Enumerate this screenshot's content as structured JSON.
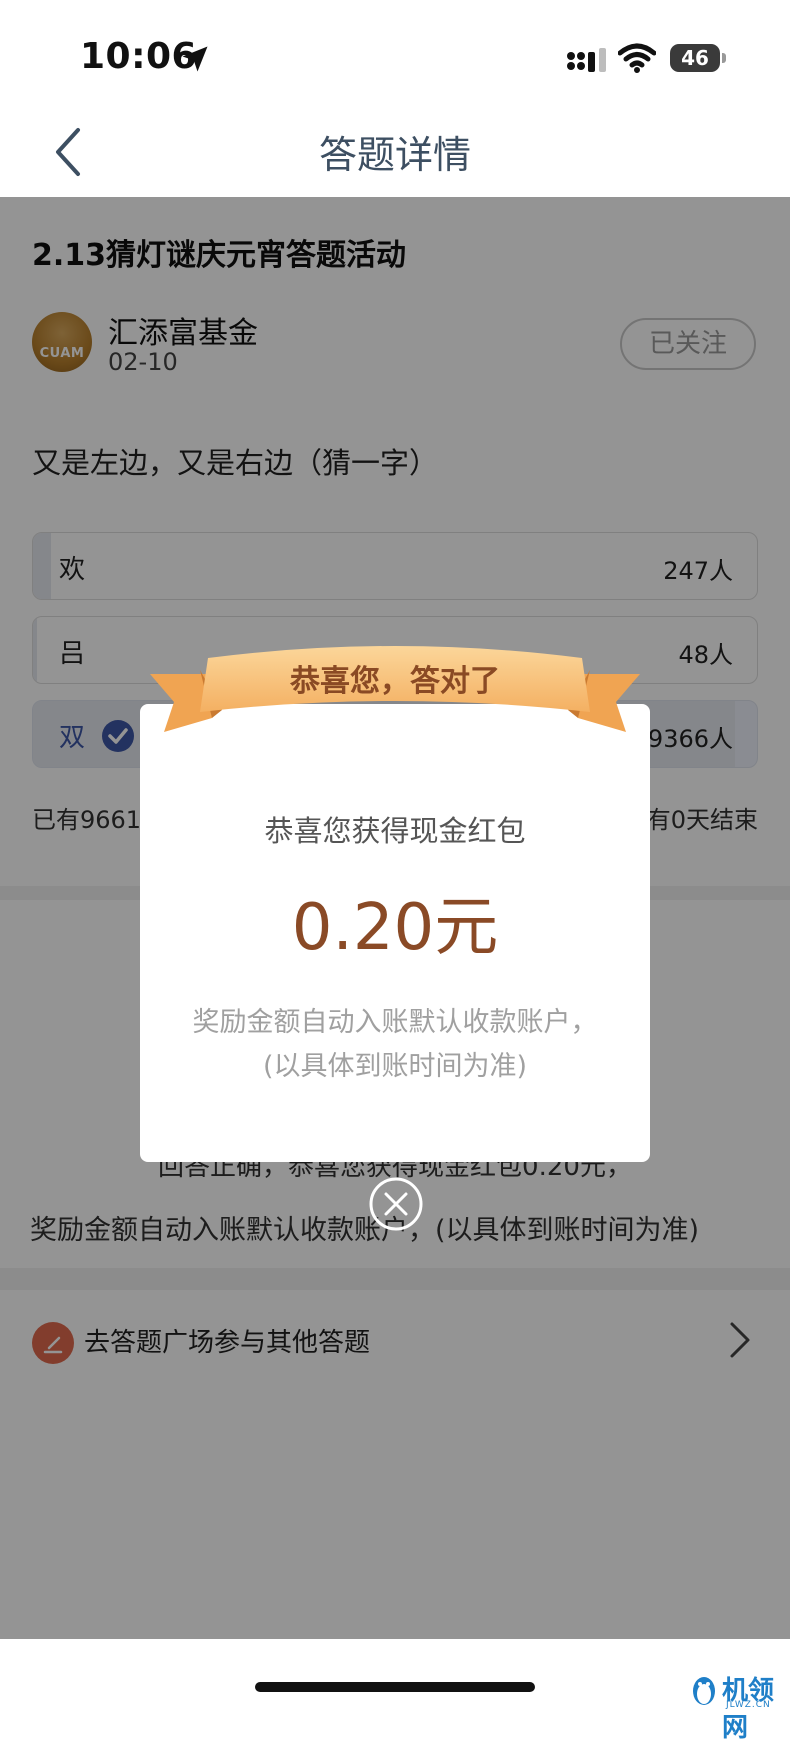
{
  "status_bar": {
    "time": "10:06",
    "battery": "46",
    "icons": [
      "location-arrow-icon",
      "cellular-signal-icon",
      "wifi-icon",
      "battery-icon"
    ]
  },
  "nav": {
    "title": "答题详情",
    "back_icon": "chevron-left-icon"
  },
  "activity": {
    "title": "2.13猜灯谜庆元宵答题活动",
    "publisher": {
      "name": "汇添富基金",
      "date": "02-10",
      "avatar_text": "CUAM",
      "follow_label": "已关注"
    },
    "question": "又是左边，又是右边（猜一字）",
    "options": [
      {
        "label": "欢",
        "count": "247人",
        "share": 0.025,
        "selected": false
      },
      {
        "label": "吕",
        "count": "48人",
        "share": 0.005,
        "selected": false
      },
      {
        "label": "双",
        "count": "9366人",
        "share": 0.97,
        "selected": true
      }
    ],
    "stats_left": "已有9661",
    "stats_right": "有0天结束"
  },
  "result": {
    "line1": "回答正确，恭喜您获得现金红包0.20元，",
    "line2": "奖励金额自动入账默认收款账户，(以具体到账时间为准)"
  },
  "answer_square": {
    "label": "去答题广场参与其他答题"
  },
  "modal": {
    "ribbon_text": "恭喜您，答对了",
    "subtitle": "恭喜您获得现金红包",
    "amount": "0.20元",
    "note_line1": "奖励金额自动入账默认收款账户，",
    "note_line2": "(以具体到账时间为准)"
  },
  "watermark": {
    "text": "机领网",
    "sub": "JLWZ.CN"
  },
  "colors": {
    "nav_title": "#3d4f62",
    "amount": "#8a4a26",
    "ribbon": "#f6c07a",
    "selected_option": "#3d56a6",
    "overlay": "rgba(0,0,0,0.42)"
  }
}
